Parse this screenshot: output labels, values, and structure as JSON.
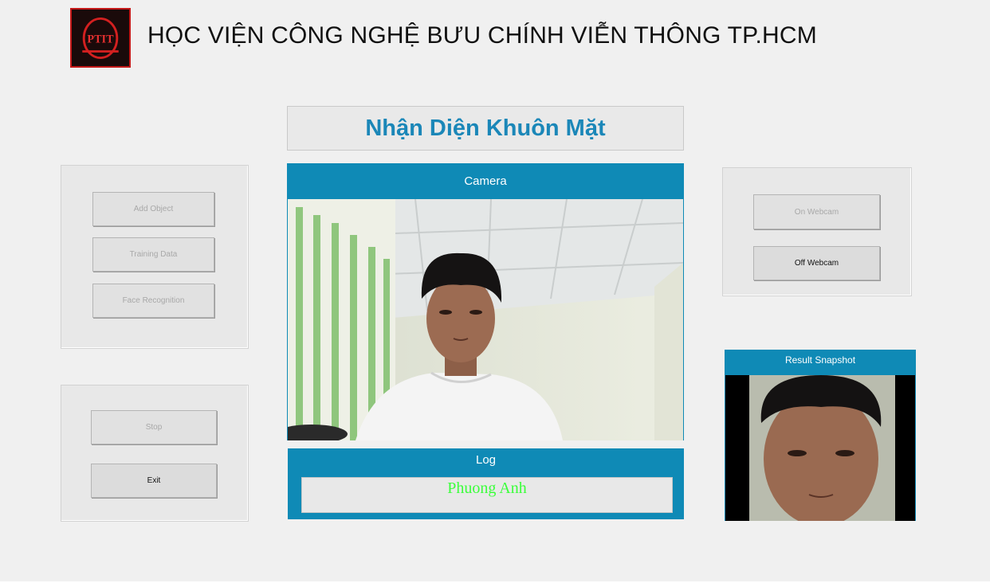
{
  "header": {
    "logo_text": "PTIT",
    "title": "HỌC VIỆN CÔNG NGHỆ BƯU CHÍNH VIỄN THÔNG TP.HCM"
  },
  "main": {
    "title": "Nhận Diện Khuôn Mặt",
    "camera_label": "Camera",
    "log_label": "Log",
    "log_value": "Phuong Anh"
  },
  "left_panel": {
    "add_object": "Add Object",
    "training_data": "Training Data",
    "face_recognition": "Face Recognition"
  },
  "control_panel": {
    "stop": "Stop",
    "exit": "Exit"
  },
  "webcam_panel": {
    "on": "On Webcam",
    "off": "Off Webcam"
  },
  "snapshot": {
    "label": "Result Snapshot"
  },
  "colors": {
    "accent": "#0f8ab6",
    "title": "#1b87b8",
    "log_text": "#3aff3a"
  }
}
